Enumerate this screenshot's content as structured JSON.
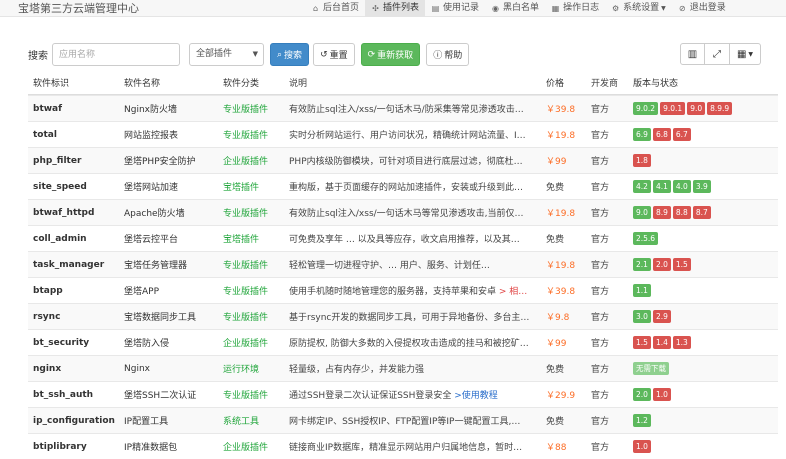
{
  "app": {
    "title": "宝塔第三方云端管理中心"
  },
  "nav": [
    {
      "icon": "home-icon",
      "glyph": "⌂",
      "label": "后台首页",
      "active": false
    },
    {
      "icon": "puzzle-icon",
      "glyph": "✣",
      "label": "插件列表",
      "active": true
    },
    {
      "icon": "list-icon",
      "glyph": "▤",
      "label": "使用记录",
      "active": false
    },
    {
      "icon": "blacklist-icon",
      "glyph": "◉",
      "label": "黑白名单",
      "active": false
    },
    {
      "icon": "log-icon",
      "glyph": "▦",
      "label": "操作日志",
      "active": false
    },
    {
      "icon": "gear-icon",
      "glyph": "⚙",
      "label": "系统设置",
      "active": false
    },
    {
      "icon": "logout-icon",
      "glyph": "⊘",
      "label": "退出登录",
      "active": false
    }
  ],
  "toolbar": {
    "search_label": "搜索",
    "search_placeholder": "应用名称",
    "filter_value": "全部插件",
    "search_btn": "搜索",
    "reset_btn": "重置",
    "refresh_btn": "重新获取",
    "help_btn": "帮助"
  },
  "table": {
    "headers": [
      "软件标识",
      "软件名称",
      "软件分类",
      "说明",
      "价格",
      "开发商",
      "版本与状态"
    ],
    "rows": [
      {
        "id": "btwaf",
        "name": "Nginx防火墙",
        "category": "专业版插件",
        "desc": "有效防止sql注入/xss/一句话木马/防采集等常见渗透攻击…",
        "price": "￥39.8",
        "dev": "官方",
        "versions": [
          {
            "v": "9.0.2",
            "c": "g"
          },
          {
            "v": "9.0.1",
            "c": "r"
          },
          {
            "v": "9.0",
            "c": "r"
          },
          {
            "v": "8.9.9",
            "c": "r"
          }
        ]
      },
      {
        "id": "total",
        "name": "网站监控报表",
        "category": "专业版插件",
        "desc": "实时分析网站运行、用户访问状况，精确统计网站流量、I…",
        "price": "￥19.8",
        "dev": "官方",
        "versions": [
          {
            "v": "6.9",
            "c": "g"
          },
          {
            "v": "6.8",
            "c": "r"
          },
          {
            "v": "6.7",
            "c": "r"
          }
        ]
      },
      {
        "id": "php_filter",
        "name": "堡塔PHP安全防护",
        "category": "企业版插件",
        "desc": "PHP内核级防御模块，可针对项目进行底层过滤，彻底杜…",
        "price": "￥99",
        "dev": "官方",
        "versions": [
          {
            "v": "1.8",
            "c": "r"
          }
        ]
      },
      {
        "id": "site_speed",
        "name": "堡塔网站加速",
        "category": "宝塔插件",
        "desc": "重构版，基于页面缓存的网站加速插件，安装或升级到此…",
        "price": "免费",
        "dev": "官方",
        "versions": [
          {
            "v": "4.2",
            "c": "g"
          },
          {
            "v": "4.1",
            "c": "g"
          },
          {
            "v": "4.0",
            "c": "g"
          },
          {
            "v": "3.9",
            "c": "g"
          }
        ]
      },
      {
        "id": "btwaf_httpd",
        "name": "Apache防火墙",
        "category": "专业版插件",
        "desc": "有效防止sql注入/xss/一句话木马等常见渗透攻击,当前仅…",
        "price": "￥19.8",
        "dev": "官方",
        "versions": [
          {
            "v": "9.0",
            "c": "g"
          },
          {
            "v": "8.9",
            "c": "r"
          },
          {
            "v": "8.8",
            "c": "r"
          },
          {
            "v": "8.7",
            "c": "r"
          }
        ]
      },
      {
        "id": "coll_admin",
        "name": "堡塔云控平台",
        "category": "宝塔插件",
        "desc": "可免费及享年 … 以及具等应存，收文启用推荐，以及其…",
        "price": "免费",
        "dev": "官方",
        "versions": [
          {
            "v": "2.5.6",
            "c": "g"
          }
        ]
      },
      {
        "id": "task_manager",
        "name": "宝塔任务管理器",
        "category": "专业版插件",
        "desc": "轻松管理一切进程守护、… 用户、服务、计划任…",
        "price": "￥19.8",
        "dev": "官方",
        "versions": [
          {
            "v": "2.1",
            "c": "g"
          },
          {
            "v": "2.0",
            "c": "r"
          },
          {
            "v": "1.5",
            "c": "r"
          }
        ]
      },
      {
        "id": "btapp",
        "name": "堡塔APP",
        "category": "专业版插件",
        "desc_pre": "使用手机随时随地管理您的服务器，支持苹果和安卓 ",
        "desc_link": "> 相…",
        "price": "￥39.8",
        "dev": "官方",
        "versions": [
          {
            "v": "1.1",
            "c": "g"
          }
        ]
      },
      {
        "id": "rsync",
        "name": "宝塔数据同步工具",
        "category": "专业版插件",
        "desc": "基于rsync开发的数据同步工具，可用于异地备份、多台主…",
        "price": "￥9.8",
        "dev": "官方",
        "versions": [
          {
            "v": "3.0",
            "c": "g"
          },
          {
            "v": "2.9",
            "c": "r"
          }
        ]
      },
      {
        "id": "bt_security",
        "name": "堡塔防入侵",
        "category": "企业版插件",
        "desc": "原防提权, 防御大多数的入侵提权攻击造成的挂马和被挖矿…",
        "price": "￥99",
        "dev": "官方",
        "versions": [
          {
            "v": "1.5",
            "c": "r"
          },
          {
            "v": "1.4",
            "c": "r"
          },
          {
            "v": "1.3",
            "c": "r"
          }
        ]
      },
      {
        "id": "nginx",
        "name": "Nginx",
        "category": "运行环境",
        "desc": "轻量级，占有内存少，并发能力强",
        "price": "免费",
        "dev": "官方",
        "versions": [
          {
            "v": "无需下载",
            "c": "lg"
          }
        ]
      },
      {
        "id": "bt_ssh_auth",
        "name": "堡塔SSH二次认证",
        "category": "专业版插件",
        "desc_pre": "通过SSH登录二次认证保证SSH登录安全 ",
        "desc_link": ">使用教程",
        "price": "￥29.9",
        "dev": "官方",
        "versions": [
          {
            "v": "2.0",
            "c": "g"
          },
          {
            "v": "1.0",
            "c": "r"
          }
        ]
      },
      {
        "id": "ip_configuration",
        "name": "IP配置工具",
        "category": "系统工具",
        "desc": "网卡绑定IP、SSH授权IP、FTP配置IP等IP一键配置工具,…",
        "price": "免费",
        "dev": "官方",
        "versions": [
          {
            "v": "1.2",
            "c": "g"
          }
        ]
      },
      {
        "id": "btiplibrary",
        "name": "IP精准数据包",
        "category": "企业版插件",
        "desc": "链接商业IP数据库，精准显示网站用户归属地信息，暂时…",
        "price": "￥88",
        "dev": "官方",
        "versions": [
          {
            "v": "1.0",
            "c": "r"
          }
        ]
      }
    ]
  }
}
